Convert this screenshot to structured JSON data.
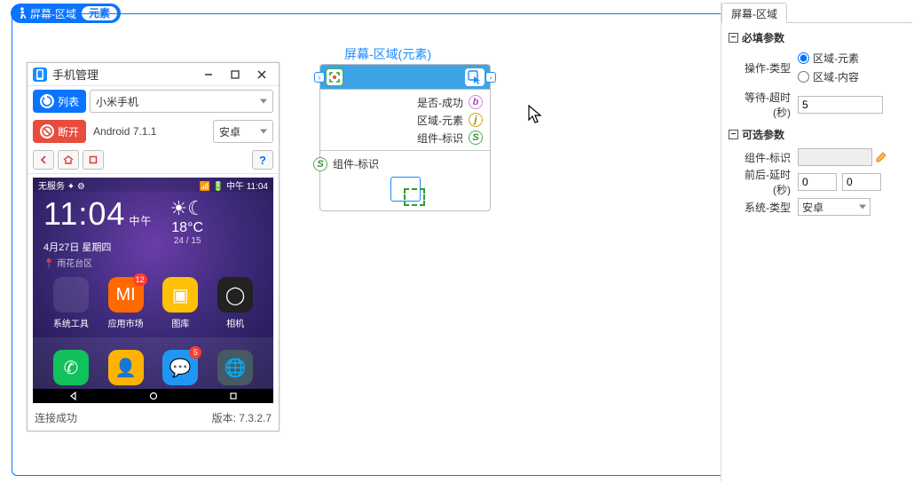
{
  "breadcrumb": {
    "label": "屏幕-区域",
    "badge": "元素"
  },
  "phone_manager": {
    "title": "手机管理",
    "list_btn": "列表",
    "device_selected": "小米手机",
    "disconnect_btn": "断开",
    "android_version": "Android 7.1.1",
    "platform_selected": "安卓",
    "status_left": "无服务",
    "status_right": "中午 11:04",
    "clock_time": "11:04",
    "clock_ampm": "中午",
    "clock_date": "4月27日 星期四",
    "clock_location": "雨花台区",
    "temp": "18°C",
    "temp_range": "24 / 15",
    "apps": [
      {
        "label": "系统工具",
        "bg": "rgba(255,255,255,.1)"
      },
      {
        "label": "应用市场",
        "bg": "#ff6a00",
        "badge": "12",
        "glyph": "MI"
      },
      {
        "label": "图库",
        "bg": "#ffc107",
        "glyph": "▣"
      },
      {
        "label": "相机",
        "bg": "#222",
        "glyph": "◯"
      }
    ],
    "dock": [
      {
        "bg": "#11c15b",
        "glyph": "✆"
      },
      {
        "bg": "#ffb300",
        "glyph": "👤"
      },
      {
        "bg": "#2196f3",
        "glyph": "💬",
        "badge": "5"
      },
      {
        "bg": "#455a64",
        "glyph": "🌐"
      }
    ],
    "footer_status": "连接成功",
    "footer_version_label": "版本:",
    "footer_version": "7.3.2.7"
  },
  "node": {
    "title": "屏幕-区域(元素)",
    "out1": "是否-成功",
    "out2": "区域-元素",
    "out3": "组件-标识",
    "in1": "组件-标识"
  },
  "panel": {
    "tab": "屏幕-区域",
    "group1": "必填参数",
    "op_label": "操作-类型",
    "op_opt1": "区域-元素",
    "op_opt2": "区域-内容",
    "wait_label": "等待-超时(秒)",
    "wait_val": "5",
    "group2": "可选参数",
    "comp_label": "组件-标识",
    "delay_label": "前后-延时(秒)",
    "delay_before": "0",
    "delay_after": "0",
    "sys_label": "系统-类型",
    "sys_val": "安卓"
  }
}
